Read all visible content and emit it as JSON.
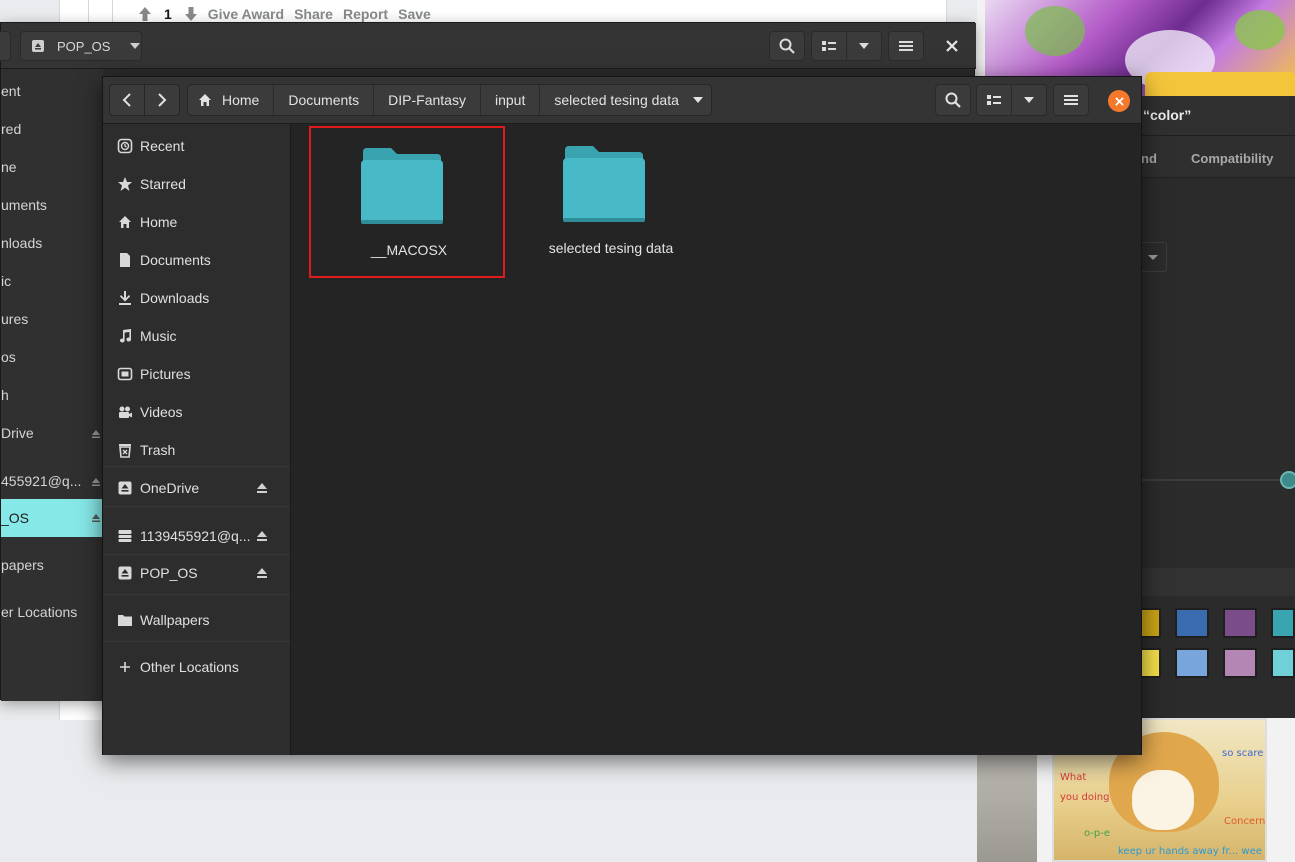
{
  "background_post": {
    "vote_count": "1",
    "actions": [
      "Give Award",
      "Share",
      "Report",
      "Save"
    ]
  },
  "back_window": {
    "path_button": "POP_OS",
    "sidebar": [
      {
        "label": "ent",
        "icon": "recent-icon"
      },
      {
        "label": "red",
        "icon": "star-icon"
      },
      {
        "label": "ne",
        "icon": "home-icon"
      },
      {
        "label": "uments",
        "icon": "document-icon"
      },
      {
        "label": "nloads",
        "icon": "download-icon"
      },
      {
        "label": "ic",
        "icon": "music-icon"
      },
      {
        "label": "ures",
        "icon": "picture-icon"
      },
      {
        "label": "os",
        "icon": "video-icon"
      },
      {
        "label": "h",
        "icon": "trash-icon"
      },
      {
        "label": "Drive",
        "icon": "drive-icon"
      },
      {
        "label": "455921@q...",
        "icon": "network-drive-icon"
      },
      {
        "label": "_OS",
        "icon": "drive-icon"
      },
      {
        "label": "papers",
        "icon": "folder-icon"
      },
      {
        "label": "er Locations",
        "icon": "plus-icon"
      }
    ]
  },
  "front_window": {
    "breadcrumbs": [
      "Home",
      "Documents",
      "DIP-Fantasy",
      "input",
      "selected tesing data"
    ],
    "sidebar": [
      {
        "label": "Recent",
        "icon": "recent-icon",
        "eject": false
      },
      {
        "label": "Starred",
        "icon": "star-icon",
        "eject": false
      },
      {
        "label": "Home",
        "icon": "home-icon",
        "eject": false
      },
      {
        "label": "Documents",
        "icon": "document-icon",
        "eject": false
      },
      {
        "label": "Downloads",
        "icon": "download-icon",
        "eject": false
      },
      {
        "label": "Music",
        "icon": "music-icon",
        "eject": false
      },
      {
        "label": "Pictures",
        "icon": "picture-icon",
        "eject": false
      },
      {
        "label": "Videos",
        "icon": "video-icon",
        "eject": false
      },
      {
        "label": "Trash",
        "icon": "trash-icon",
        "eject": false
      },
      {
        "label": "OneDrive",
        "icon": "drive-icon",
        "eject": true
      },
      {
        "label": "1139455921@q...",
        "icon": "network-drive-icon",
        "eject": true
      },
      {
        "label": "POP_OS",
        "icon": "drive-icon",
        "eject": true
      },
      {
        "label": "Wallpapers",
        "icon": "folder-icon",
        "eject": false
      },
      {
        "label": "Other Locations",
        "icon": "plus-icon",
        "eject": false
      }
    ],
    "files": [
      {
        "name": "__MACOSX",
        "type": "folder",
        "highlighted": true
      },
      {
        "name": "selected tesing data",
        "type": "folder",
        "highlighted": false
      }
    ]
  },
  "right_app": {
    "title": "“color”",
    "tabs": [
      "nd",
      "Compatibility"
    ]
  },
  "meme_text": [
    "so scare",
    "What",
    "you doing",
    "Concern",
    "o-p-e",
    "keep ur hands away fr... wee"
  ],
  "colors": {
    "folder": "#48b9c7",
    "folder_tab": "#3aa3b0",
    "selection": "#87e8e8",
    "highlight_box": "#e01b1b",
    "close_button": "#f5792a",
    "window_bg": "#242424",
    "header_bg": "#343434"
  }
}
